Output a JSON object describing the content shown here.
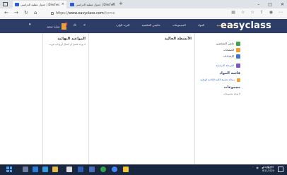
{
  "browser": {
    "tabs": [
      {
        "label": "جدول عملية الدراسي | Dleches"
      },
      {
        "label": "جدول عملية الدراسي | Dleches"
      }
    ],
    "url_scheme": "https://",
    "url_host": "www.easyclass.com",
    "url_path": "/home",
    "newtab_label": "+"
  },
  "header": {
    "logo_part1": "easy",
    "logo_part2": "class",
    "nav": [
      "الصفحة الرئيسية",
      "المواد",
      "المجموعات",
      "مكتبتي التعليمية",
      "البريد الوارد"
    ],
    "user_name": "سارة سعيد"
  },
  "left_panel": {
    "title": "المواعيد النهائية",
    "text": "لا يوجد فاصل أو أعمال أو واجب قريب"
  },
  "mid_panel": {
    "title": "الأنشطة الحالية"
  },
  "right_panel": {
    "menu": [
      {
        "label": "ملفي الشخصي"
      },
      {
        "label": "الصفحات"
      },
      {
        "label": "الإعدادات"
      }
    ],
    "link_label": "المرحلة الدراسية",
    "sec1_title": "قائمة المواد",
    "sec1_item": "رسالة تعليمية الكلية الإكادية الوطنية",
    "sec2_title": "مجموعات",
    "sec2_item": "لا توجد مجموعات"
  },
  "taskbar": {
    "time": "11:38 PM",
    "date": "8/11/2020",
    "lang": "ENG"
  },
  "colors": {
    "header_bg": "#2e3d68",
    "nav_active": "#ffd24d",
    "taskbar_bg": "#18273f",
    "link": "#2a5bd7"
  }
}
